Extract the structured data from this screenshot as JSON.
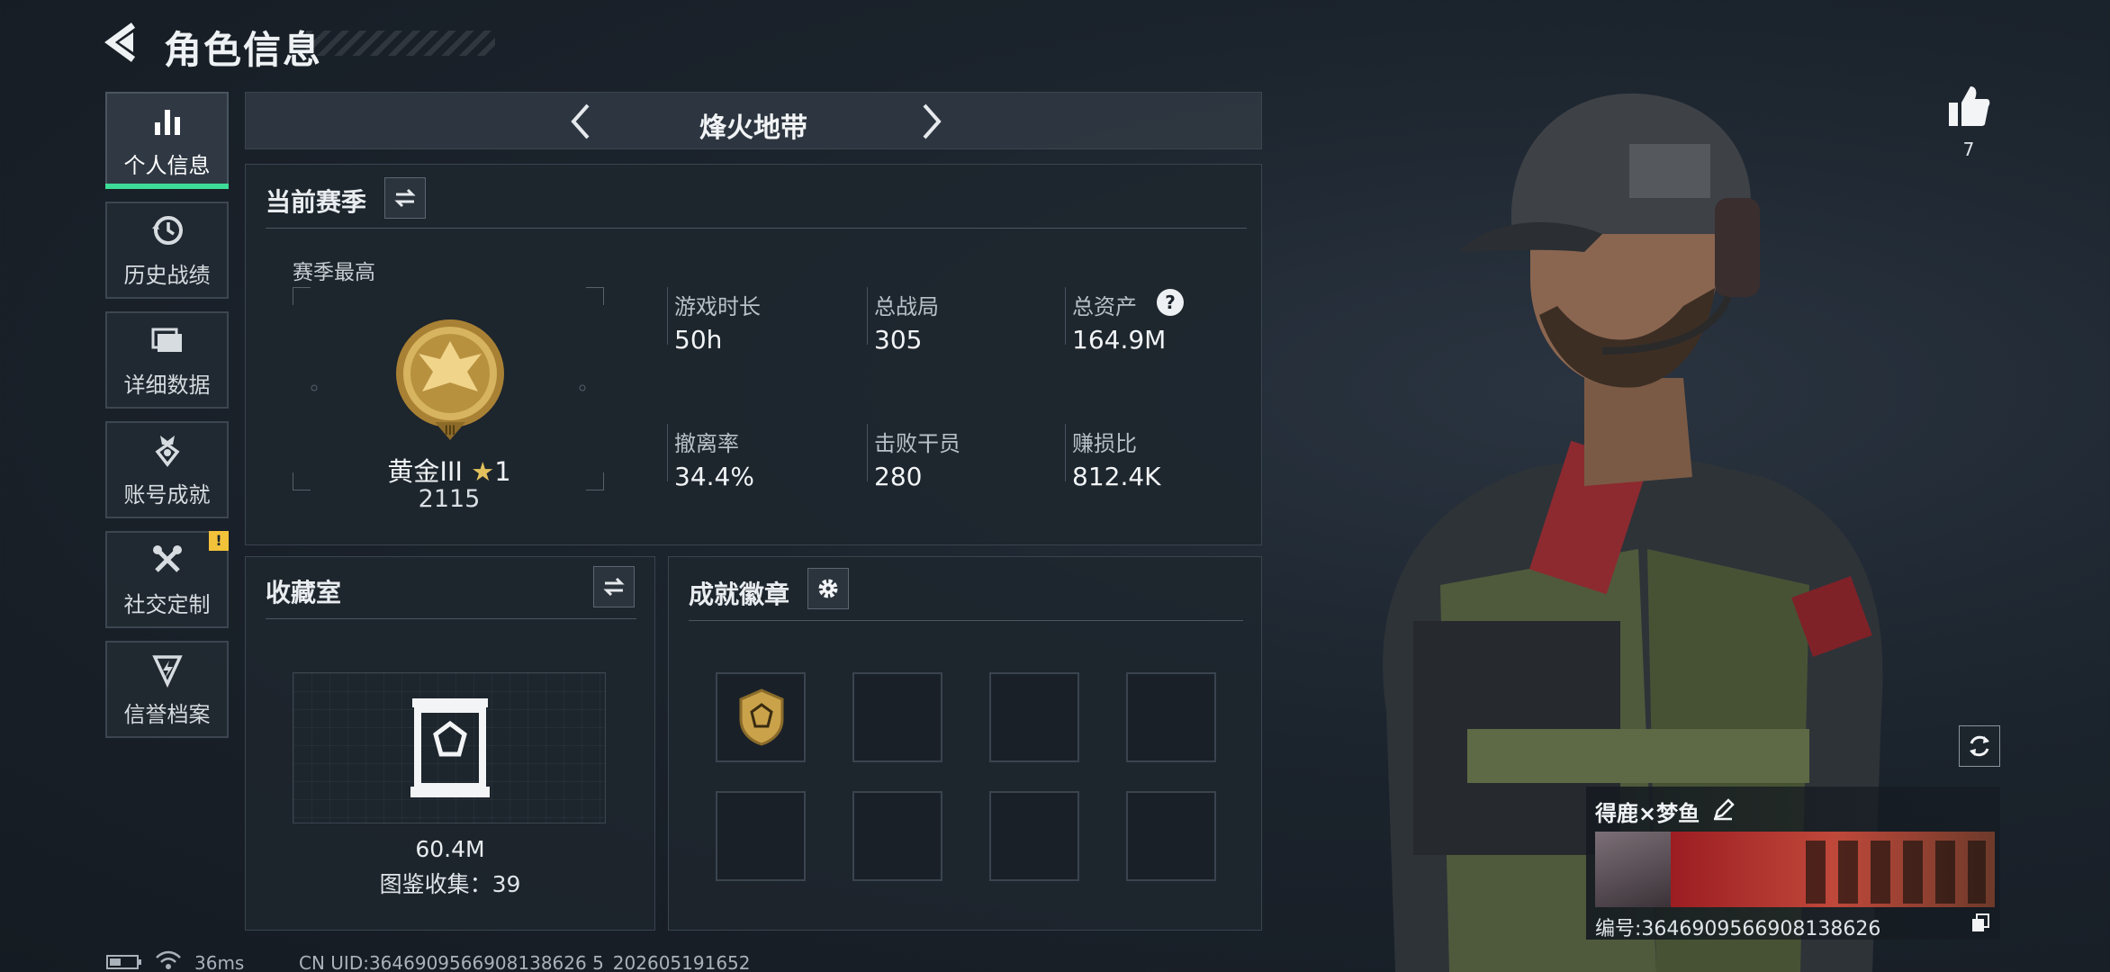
{
  "header": {
    "title": "角色信息"
  },
  "sidebar": {
    "items": [
      {
        "label": "个人信息",
        "active": true,
        "icon": "bar-chart-icon"
      },
      {
        "label": "历史战绩",
        "active": false,
        "icon": "history-clock-icon"
      },
      {
        "label": "详细数据",
        "active": false,
        "icon": "folder-stack-icon"
      },
      {
        "label": "账号成就",
        "active": false,
        "icon": "medal-icon"
      },
      {
        "label": "社交定制",
        "active": false,
        "icon": "tools-icon",
        "badge": "!"
      },
      {
        "label": "信誉档案",
        "active": false,
        "icon": "shield-bolt-icon"
      }
    ]
  },
  "mode": {
    "label": "烽火地带"
  },
  "season": {
    "title": "当前赛季",
    "subtitle": "赛季最高",
    "rank_name": "黄金III",
    "rank_stars": "1",
    "rank_score": "2115",
    "stats": [
      {
        "label": "游戏时长",
        "value": "50h"
      },
      {
        "label": "总战局",
        "value": "305"
      },
      {
        "label": "总资产",
        "value": "164.9M",
        "help": "?"
      },
      {
        "label": "撤离率",
        "value": "34.4%"
      },
      {
        "label": "击败干员",
        "value": "280"
      },
      {
        "label": "赚损比",
        "value": "812.4K"
      }
    ]
  },
  "collection": {
    "title": "收藏室",
    "value": "60.4M",
    "catalog_label": "图鉴收集：39"
  },
  "achievements": {
    "title": "成就徽章",
    "slots": 8,
    "filled": 1
  },
  "likes": {
    "count": "7"
  },
  "character": {
    "name": "得鹿×梦鱼",
    "code": "编号:3646909566908138626"
  },
  "status": {
    "ping": "36ms",
    "uid": "CN UID:3646909566908138626 5_202605191652"
  },
  "colors": {
    "accent": "#3ddc97",
    "warning": "#f2c23a",
    "gold": "#c9a24a"
  }
}
